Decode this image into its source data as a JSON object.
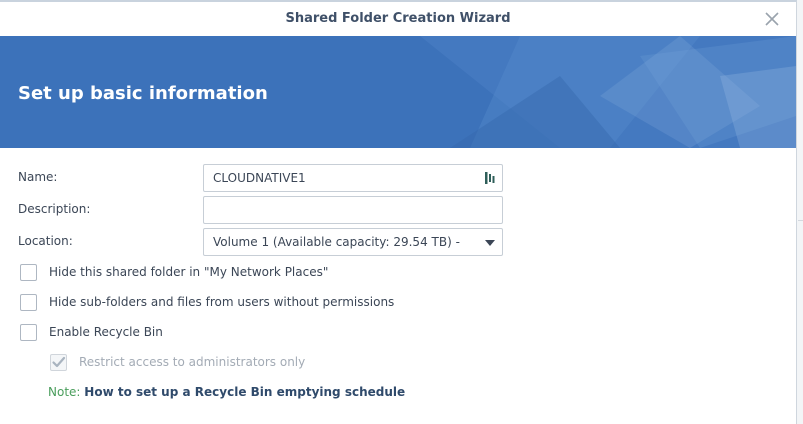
{
  "window": {
    "title": "Shared Folder Creation Wizard"
  },
  "header": {
    "title": "Set up basic information",
    "background_color": "#3c72ba"
  },
  "form": {
    "name": {
      "label": "Name:",
      "value": "CLOUDNATIVE1"
    },
    "description": {
      "label": "Description:",
      "value": "",
      "placeholder": ""
    },
    "location": {
      "label": "Location:",
      "selected": "Volume 1 (Available capacity:  29.54 TB) -"
    }
  },
  "options": {
    "hide_network_places": {
      "label": "Hide this shared folder in \"My Network Places\"",
      "checked": false
    },
    "hide_subfolders": {
      "label": "Hide sub-folders and files from users without permissions",
      "checked": false
    },
    "enable_recycle_bin": {
      "label": "Enable Recycle Bin",
      "checked": false
    },
    "restrict_admins": {
      "label": "Restrict access to administrators only",
      "checked": true,
      "disabled": true
    }
  },
  "note": {
    "label": "Note:",
    "link_text": "How to set up a Recycle Bin emptying schedule"
  },
  "colors": {
    "accent": "#3c72ba",
    "note_label": "#4a9e5c",
    "link": "#2f4a6b"
  }
}
